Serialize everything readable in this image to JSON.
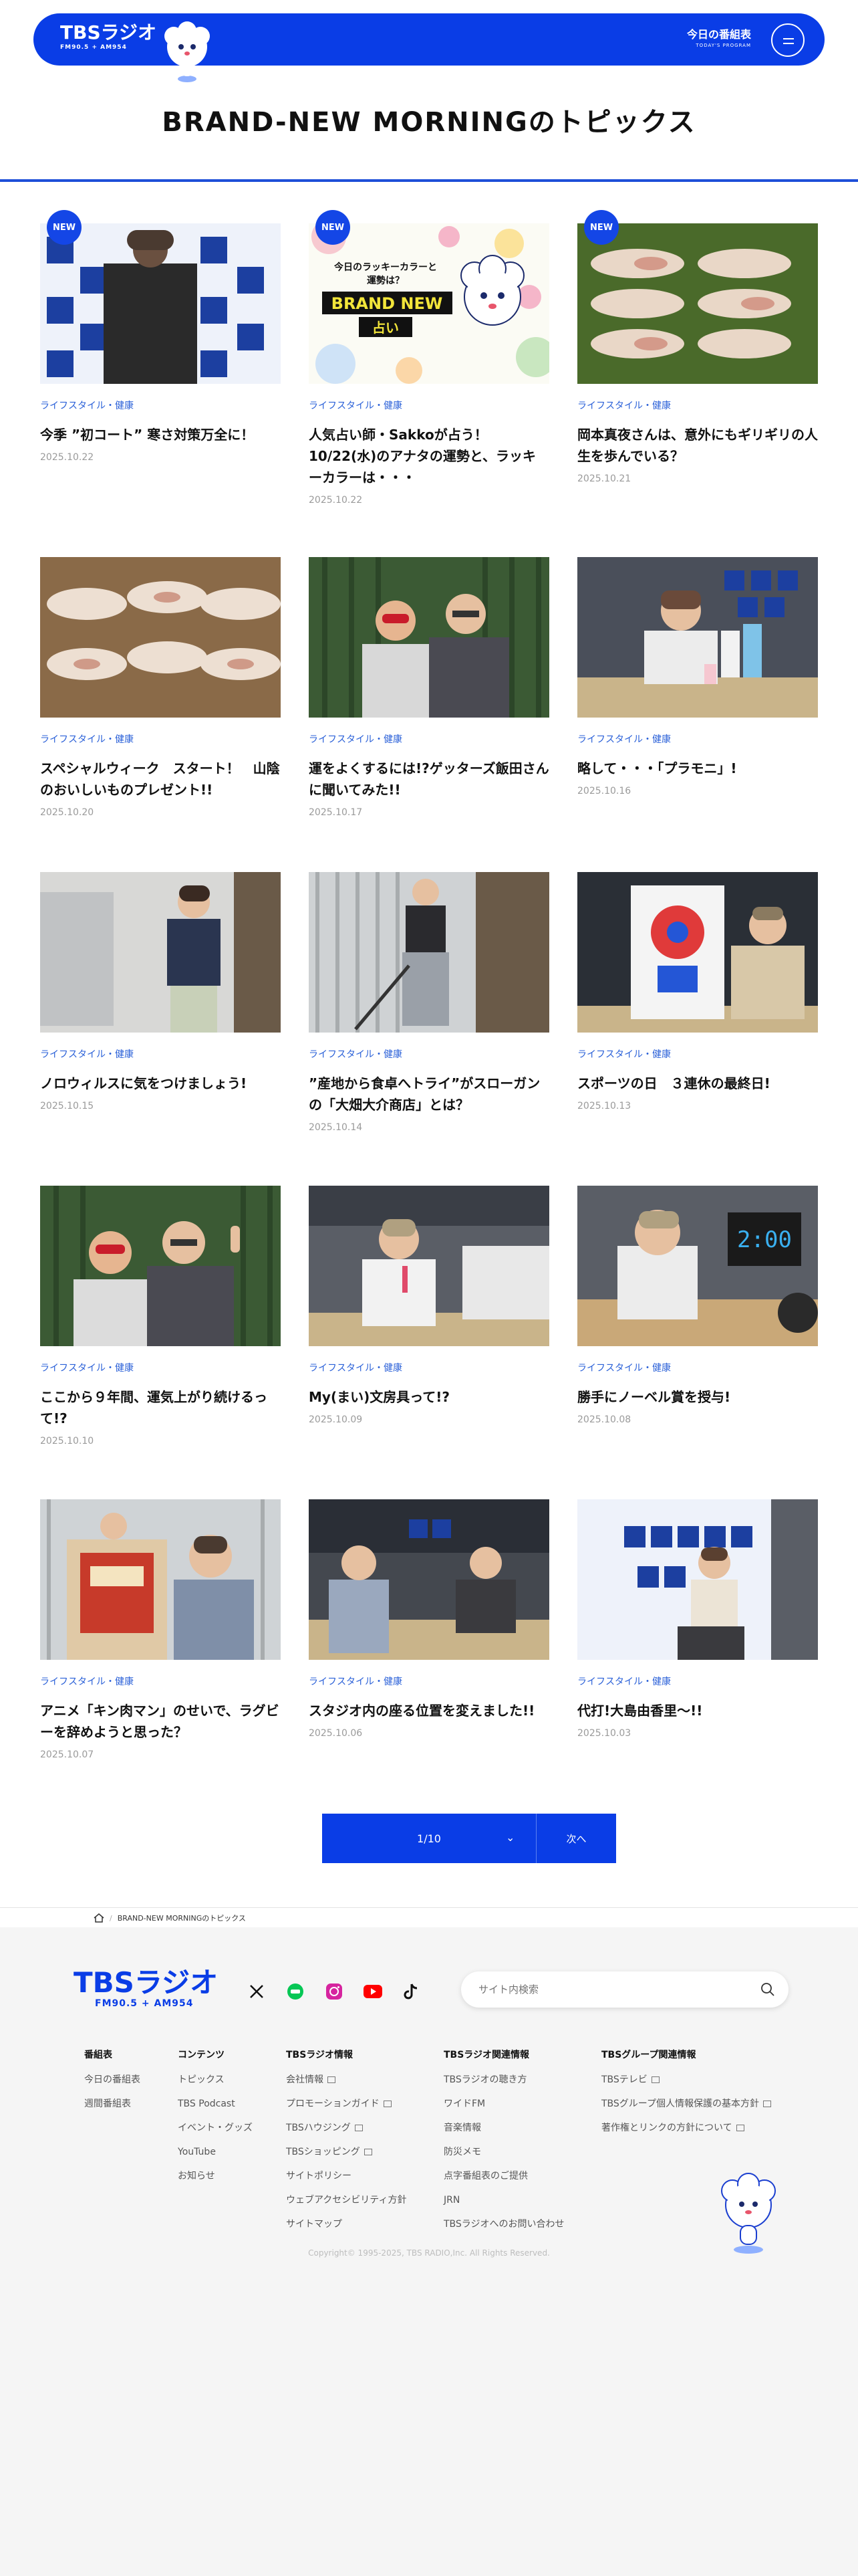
{
  "header": {
    "logo_main": "TBSラジオ",
    "logo_sub": "FM90.5 + AM954",
    "program_label": "今日の番組表",
    "program_sub": "TODAY'S PROGRAM"
  },
  "page_title": "BRAND-NEW MORNINGのトピックス",
  "new_label": "NEW",
  "cards": [
    {
      "category": "ライフスタイル・健康",
      "title": "今季 ”初コート” 寒さ対策万全に！",
      "date": "2025.10.22"
    },
    {
      "category": "ライフスタイル・健康",
      "title": "人気占い師・Sakkoが占う！10/22(水)のアナタの運勢と、ラッキーカラーは・・・",
      "date": "2025.10.22",
      "thumb_text_1": "今日のラッキーカラーと",
      "thumb_text_2": "運勢は？",
      "thumb_text_3": "BRAND NEW",
      "thumb_text_4": "占い"
    },
    {
      "category": "ライフスタイル・健康",
      "title": "岡本真夜さんは、意外にもギリギリの人生を歩んでいる？",
      "date": "2025.10.21"
    },
    {
      "category": "ライフスタイル・健康",
      "title": "スペシャルウィーク　スタート！　山陰のおいしいものプレゼント!!",
      "date": "2025.10.20"
    },
    {
      "category": "ライフスタイル・健康",
      "title": "運をよくするには!?ゲッターズ飯田さんに聞いてみた!!",
      "date": "2025.10.17"
    },
    {
      "category": "ライフスタイル・健康",
      "title": "略して・・・「プラモニ」!",
      "date": "2025.10.16"
    },
    {
      "category": "ライフスタイル・健康",
      "title": "ノロウィルスに気をつけましょう!",
      "date": "2025.10.15"
    },
    {
      "category": "ライフスタイル・健康",
      "title": "”産地から食卓へトライ”がスローガンの「大畑大介商店」とは？",
      "date": "2025.10.14"
    },
    {
      "category": "ライフスタイル・健康",
      "title": "スポーツの日　３連休の最終日!",
      "date": "2025.10.13"
    },
    {
      "category": "ライフスタイル・健康",
      "title": "ここから９年間、運気上がり続けるって!?",
      "date": "2025.10.10"
    },
    {
      "category": "ライフスタイル・健康",
      "title": "My(まい)文房具って!?",
      "date": "2025.10.09"
    },
    {
      "category": "ライフスタイル・健康",
      "title": "勝手にノーベル賞を授与!",
      "date": "2025.10.08",
      "thumb_clock": "2:00"
    },
    {
      "category": "ライフスタイル・健康",
      "title": "アニメ「キン肉マン」のせいで、ラグビーを辞めようと思った？",
      "date": "2025.10.07"
    },
    {
      "category": "ライフスタイル・健康",
      "title": "スタジオ内の座る位置を変えました!!",
      "date": "2025.10.06"
    },
    {
      "category": "ライフスタイル・健康",
      "title": "代打!大島由香里〜!!",
      "date": "2025.10.03"
    }
  ],
  "pagination": {
    "current": "1/10",
    "next": "次へ"
  },
  "breadcrumb": {
    "current": "BRAND-NEW MORNINGのトピックス"
  },
  "footer": {
    "logo_main": "TBSラジオ",
    "logo_sub": "FM90.5 + AM954",
    "search_placeholder": "サイト内検索",
    "columns": [
      {
        "heading": "番組表",
        "items": [
          "今日の番組表",
          "週間番組表"
        ]
      },
      {
        "heading": "コンテンツ",
        "items": [
          "トピックス",
          "TBS Podcast",
          "イベント・グッズ",
          "YouTube",
          "お知らせ"
        ]
      },
      {
        "heading": "TBSラジオ情報",
        "items": [
          "会社情報",
          "プロモーションガイド",
          "TBSハウジング",
          "TBSショッピング",
          "サイトポリシー",
          "ウェブアクセシビリティ方針",
          "サイトマップ"
        ]
      },
      {
        "heading": "TBSラジオ関連情報",
        "items": [
          "TBSラジオの聴き方",
          "ワイドFM",
          "音楽情報",
          "防災メモ",
          "点字番組表のご提供",
          "JRN",
          "TBSラジオへのお問い合わせ"
        ]
      },
      {
        "heading": "TBSグループ関連情報",
        "items": [
          "TBSテレビ",
          "TBSグループ個人情報保護の基本方針",
          "著作権とリンクの方針について"
        ]
      }
    ],
    "copyright": "Copyright© 1995-2025, TBS RADIO,Inc. All Rights Reserved."
  },
  "colors": {
    "brand_blue": "#0a3de6",
    "category_blue": "#2a60d8",
    "date_gray": "#9a9a9a"
  }
}
